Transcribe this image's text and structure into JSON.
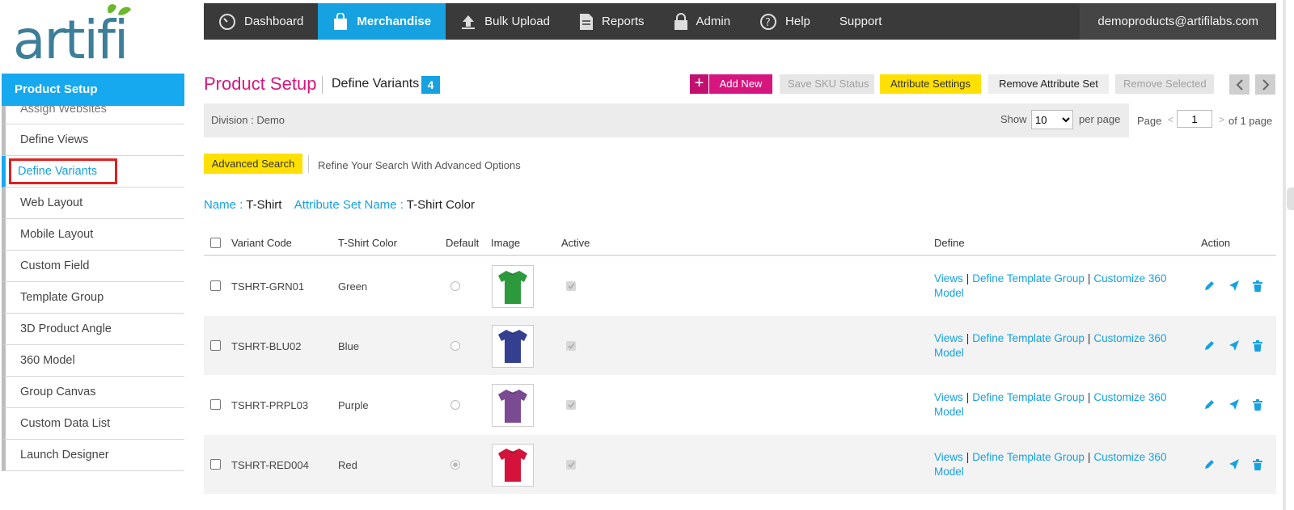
{
  "logo": {
    "text": "artifi",
    "color": "#3d7e99",
    "leaf_color": "#6ab82b"
  },
  "topnav": {
    "items": [
      {
        "label": "Dashboard",
        "icon": "gauge-icon"
      },
      {
        "label": "Merchandise",
        "icon": "shopping-bag-icon",
        "active": true
      },
      {
        "label": "Bulk Upload",
        "icon": "upload-icon"
      },
      {
        "label": "Reports",
        "icon": "document-icon"
      },
      {
        "label": "Admin",
        "icon": "lock-icon"
      },
      {
        "label": "Help",
        "icon": "help-icon"
      },
      {
        "label": "Support",
        "icon": ""
      }
    ],
    "user": "demoproducts@artifilabs.com"
  },
  "sidebar": {
    "title": "Product Setup",
    "items": [
      {
        "label": "Assign Websites"
      },
      {
        "label": "Define Views"
      },
      {
        "label": "Define Variants",
        "selected": true
      },
      {
        "label": "Web Layout"
      },
      {
        "label": "Mobile Layout"
      },
      {
        "label": "Custom Field"
      },
      {
        "label": "Template Group"
      },
      {
        "label": "3D Product Angle"
      },
      {
        "label": "360 Model"
      },
      {
        "label": "Group Canvas"
      },
      {
        "label": "Custom Data List"
      },
      {
        "label": "Launch Designer"
      }
    ]
  },
  "header": {
    "title": "Product Setup",
    "subtitle": "Define Variants",
    "count": "4",
    "buttons": {
      "add_new": "Add New",
      "add_plus": "+",
      "save_sku": "Save SKU Status",
      "attribute_settings": "Attribute Settings",
      "remove_attribute_set": "Remove Attribute Set",
      "remove_selected": "Remove Selected"
    }
  },
  "filter": {
    "division": "Division :  Demo",
    "show_label": "Show",
    "per_page_value": "10",
    "per_page_label": "per page",
    "page_label": "Page",
    "page_prev": "<",
    "page_value": "1",
    "page_next": ">",
    "page_of": "of 1 page"
  },
  "advanced_search": {
    "button": "Advanced Search",
    "hint": "Refine Your Search With Advanced Options"
  },
  "info": {
    "name_key": "Name :",
    "name_value": "T-Shirt",
    "attr_key": "Attribute Set Name :",
    "attr_value": "T-Shirt Color"
  },
  "table": {
    "columns": {
      "variant_code": "Variant Code",
      "color": "T-Shirt Color",
      "default": "Default",
      "image": "Image",
      "active": "Active",
      "define": "Define",
      "action": "Action"
    },
    "define_links": {
      "views": "Views",
      "template_group": "Define Template Group",
      "customize": "Customize 360 Model",
      "pipe": "|"
    },
    "rows": [
      {
        "code": "TSHRT-GRN01",
        "color": "Green",
        "default": false,
        "shirt_color": "#2c9a3c"
      },
      {
        "code": "TSHRT-BLU02",
        "color": "Blue",
        "default": false,
        "shirt_color": "#34408f"
      },
      {
        "code": "TSHRT-PRPL03",
        "color": "Purple",
        "default": false,
        "shirt_color": "#7a4a92"
      },
      {
        "code": "TSHRT-RED004",
        "color": "Red",
        "default": true,
        "shirt_color": "#d4123a"
      }
    ]
  },
  "colors": {
    "accent": "#16a1e0",
    "brand_pink": "#d6157e",
    "yellow": "#ffe000",
    "nav_bg": "#3a3a3a"
  }
}
